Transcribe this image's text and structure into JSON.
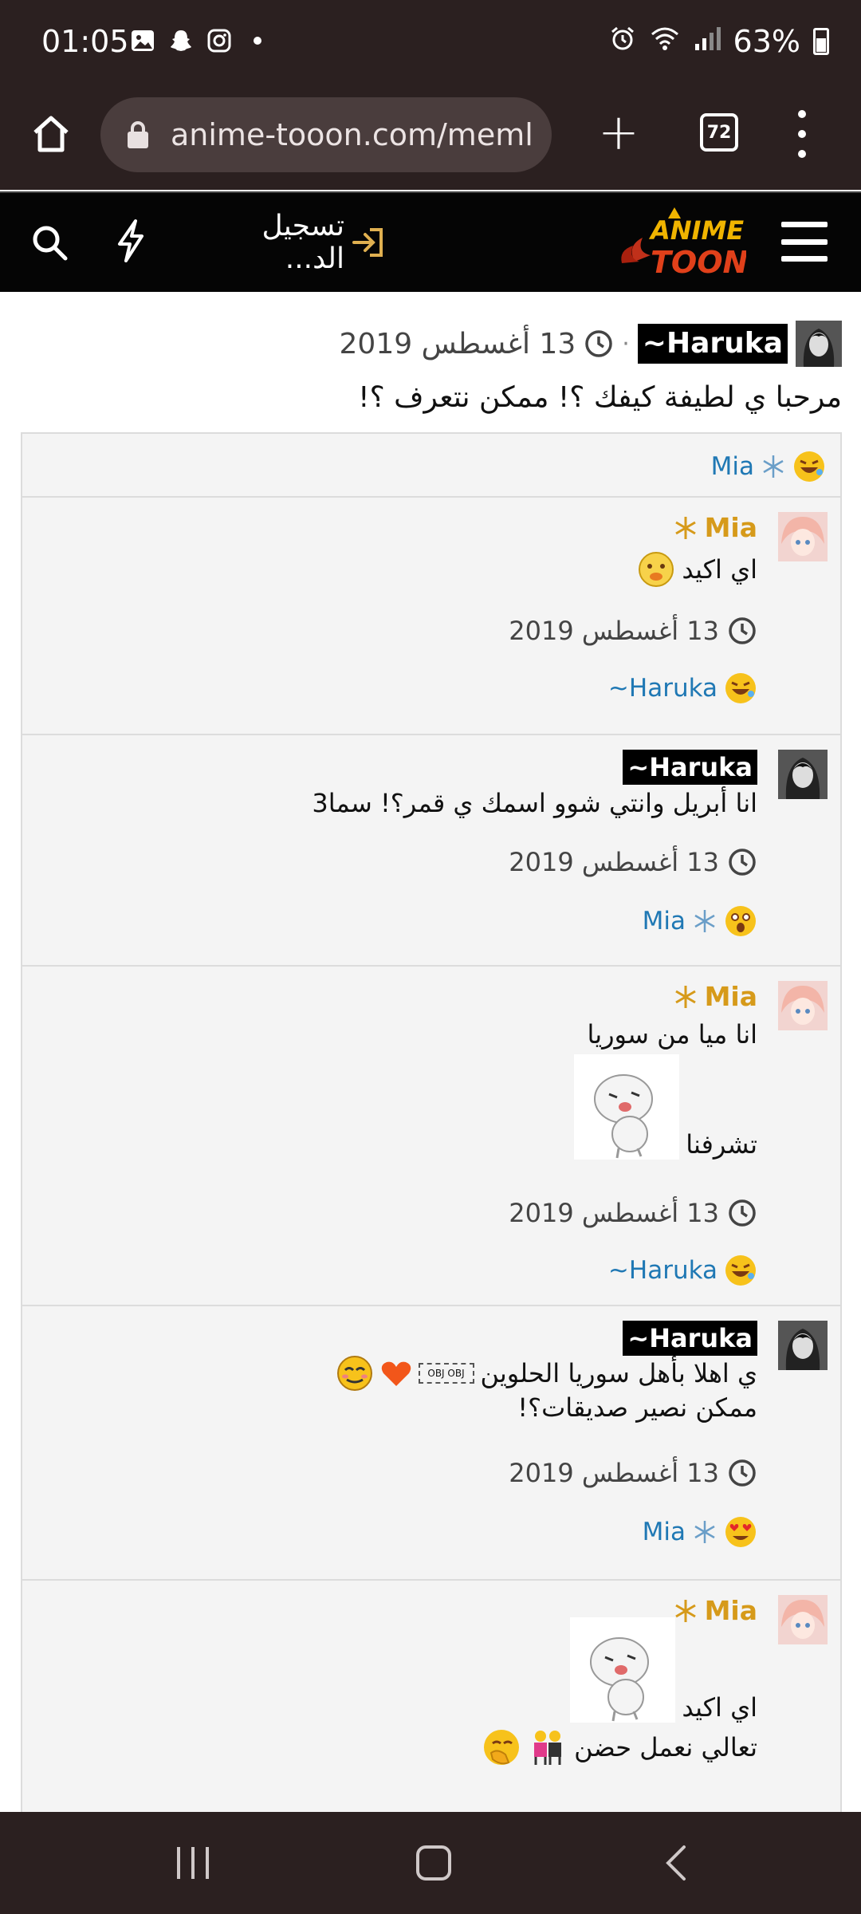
{
  "status_bar": {
    "time": "01:05",
    "battery": "63%"
  },
  "browser": {
    "url": "anime-tooon.com/meml",
    "tab_count": "72"
  },
  "site_header": {
    "login_label": "تسجيل الد...",
    "logo_text_top": "ANIME",
    "logo_text_bottom": "TOON"
  },
  "post": {
    "author": "Haruka~",
    "date": "13 أغسطس 2019",
    "text": "مرحبا ي لطيفة كيفك ؟! ممكن نتعرف ؟!",
    "reaction_user": "Mia"
  },
  "comments": [
    {
      "author": "Mia",
      "lines": [
        "اي اكيد"
      ],
      "date": "13 أغسطس 2019",
      "reaction_user": "Haruka~"
    },
    {
      "author": "Haruka~",
      "lines": [
        "انا أبريل وانتي شوو اسمك ي قمر؟! سما3"
      ],
      "date": "13 أغسطس 2019",
      "reaction_user": "Mia"
    },
    {
      "author": "Mia",
      "lines": [
        "انا ميا من سوريا",
        "تشرفنا"
      ],
      "date": "13 أغسطس 2019",
      "reaction_user": "Haruka~"
    },
    {
      "author": "Haruka~",
      "lines": [
        "ي اهلا بأهل سوريا الحلوين",
        "ممكن نصير صديقات؟!"
      ],
      "date": "13 أغسطس 2019",
      "reaction_user": "Mia"
    },
    {
      "author": "Mia",
      "lines": [
        "اي اكيد",
        "تعالي نعمل حضن"
      ]
    }
  ],
  "colors": {
    "bar_bg": "#2b2020",
    "header_bg": "#050505",
    "mia_gold": "#d69a1a",
    "link_blue": "#1f78b4",
    "thread_bg": "#f4f4f4"
  }
}
